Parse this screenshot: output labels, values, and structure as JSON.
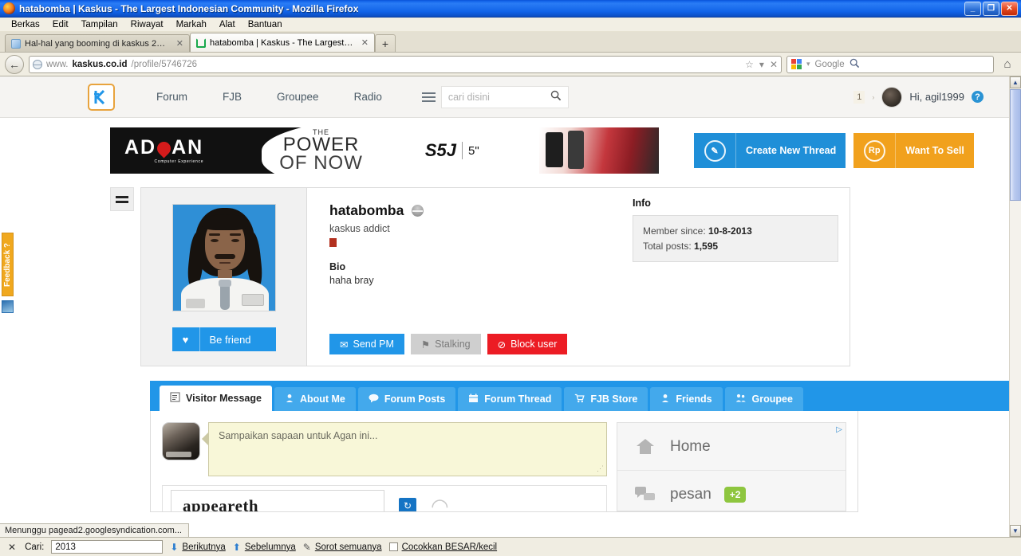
{
  "window": {
    "title": "hatabomba | Kaskus - The Largest Indonesian Community - Mozilla Firefox",
    "minimize": "_",
    "maximize": "❐",
    "close": "✕"
  },
  "menubar": [
    {
      "label": "Berkas"
    },
    {
      "label": "Edit"
    },
    {
      "label": "Tampilan"
    },
    {
      "label": "Riwayat"
    },
    {
      "label": "Markah"
    },
    {
      "label": "Alat"
    },
    {
      "label": "Bantuan"
    }
  ],
  "browser_tabs": [
    {
      "label": "Hal-hal yang booming di kaskus 2010-201 ...",
      "close": "✕",
      "active": false
    },
    {
      "label": "hatabomba | Kaskus - The Largest Indon...",
      "close": "✕",
      "active": true
    }
  ],
  "newtab_label": "+",
  "urlbar": {
    "back_glyph": "←",
    "url_prefix": "www.",
    "url_domain": "kaskus.co.id",
    "url_path": "/profile/5746726",
    "star_glyph": "☆",
    "dropdown_glyph": "▾",
    "stop_glyph": "✕"
  },
  "search": {
    "engine": "Google",
    "engine_caret": "▾",
    "magnifier": "🔍"
  },
  "home_glyph": "⌂",
  "kaskus_header": {
    "logo_text": "K",
    "nav": [
      {
        "label": "Forum"
      },
      {
        "label": "FJB"
      },
      {
        "label": "Groupee"
      },
      {
        "label": "Radio"
      }
    ],
    "search_placeholder": "cari disini",
    "search_icon": "search-icon",
    "notification_count": "1",
    "caret": "›",
    "greeting": "Hi, agil1999",
    "help_glyph": "?"
  },
  "ad_banner": {
    "brand": "AD",
    "brand_tail": "AN",
    "brand_sub": "Computer Experience",
    "line1": "THE",
    "line2": "POWER",
    "line3": "OF NOW",
    "model": "S5J",
    "size": "5\""
  },
  "cta": [
    {
      "icon": "pencil-icon",
      "icon_glyph": "✎",
      "label": "Create New Thread",
      "color": "#1f8fd8"
    },
    {
      "icon": "rupiah-icon",
      "icon_glyph": "Rp",
      "label": "Want To Sell",
      "color": "#f1a11d"
    }
  ],
  "profile": {
    "username": "hatabomba",
    "status": "offline",
    "rank": "kaskus addict",
    "bio_label": "Bio",
    "bio_text": "haha bray",
    "be_friend": "Be friend",
    "be_friend_icon": "♥",
    "actions": [
      {
        "label": "Send PM",
        "icon": "envelope-icon",
        "glyph": "✉",
        "style": "blue"
      },
      {
        "label": "Stalking",
        "icon": "bookmark-icon",
        "glyph": "⚑",
        "style": "grey"
      },
      {
        "label": "Block user",
        "icon": "block-icon",
        "glyph": "⊘",
        "style": "red"
      }
    ],
    "info_title": "Info",
    "info": [
      {
        "label": "Member since:",
        "value": "10-8-2013"
      },
      {
        "label": "Total posts:",
        "value": "1,595"
      }
    ]
  },
  "profile_tabs": [
    {
      "label": "Visitor Message",
      "icon": "note-icon",
      "glyph": "📝",
      "active": true
    },
    {
      "label": "About Me",
      "icon": "person-icon",
      "glyph": "👤",
      "active": false
    },
    {
      "label": "Forum Posts",
      "icon": "comment-icon",
      "glyph": "💬",
      "active": false
    },
    {
      "label": "Forum Thread",
      "icon": "calendar-icon",
      "glyph": "🗓",
      "active": false
    },
    {
      "label": "FJB Store",
      "icon": "cart-icon",
      "glyph": "🛒",
      "active": false
    },
    {
      "label": "Friends",
      "icon": "friends-icon",
      "glyph": "👤",
      "active": false
    },
    {
      "label": "Groupee",
      "icon": "groupee-icon",
      "glyph": "👥",
      "active": false
    }
  ],
  "visitor_message": {
    "placeholder": "Sampaikan sapaan untuk Agan ini...",
    "value": "",
    "captcha_text": "appeareth",
    "refresh_glyph": "↻",
    "audio_glyph": "◠"
  },
  "sidebar_ad": {
    "adchoices_glyph": "▷",
    "items": [
      {
        "icon": "home-icon",
        "glyph": "⌂",
        "label": "Home",
        "badge": ""
      },
      {
        "icon": "message-icon",
        "glyph": "💬",
        "label": "pesan",
        "badge": "+2"
      }
    ]
  },
  "feedback_tab": {
    "label": "Feedback ?"
  },
  "statusbar": {
    "text": "Menunggu pagead2.googlesyndication.com..."
  },
  "findbar": {
    "close_glyph": "✕",
    "label": "Cari:",
    "value": "2013",
    "next": "Berikutnya",
    "next_glyph": "⬇",
    "prev": "Sebelumnya",
    "prev_glyph": "⬆",
    "highlight": "Sorot semuanya",
    "highlight_glyph": "✎",
    "match_case": "Cocokkan BESAR/kecil"
  },
  "colors": {
    "kaskus_blue": "#2196e8",
    "cta_orange": "#f1a11d",
    "danger_red": "#ec1c24",
    "badge_green": "#8ec63f",
    "feedback_orange": "#f0a81e"
  }
}
